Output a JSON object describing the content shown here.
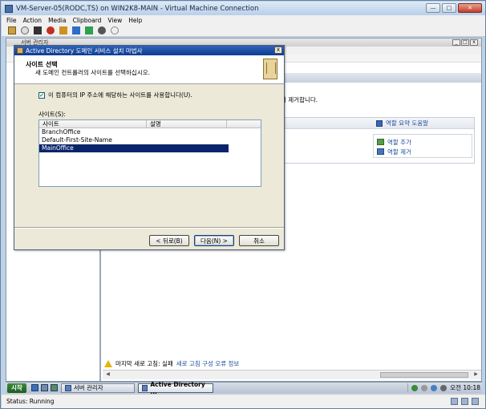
{
  "vm": {
    "title": "VM-Server-05(RODC,TS) on WIN2K8-MAIN - Virtual Machine Connection",
    "menu": [
      "File",
      "Action",
      "Media",
      "Clipboard",
      "View",
      "Help"
    ],
    "window_buttons": {
      "minimize": "—",
      "maximize": "□",
      "close": "✕"
    }
  },
  "server_manager": {
    "title": "서버 관리자",
    "description": "서 제거합니다.",
    "panel_header_link": "역할 요약 도움말",
    "actions": [
      "역할 추가",
      "역할 제거"
    ],
    "status_text": "마지막 새로 고침: 실패",
    "status_link": "새로 고침 구성 오류 정보"
  },
  "dialog": {
    "title": "Active Directory 도메인 서비스 설치 마법사",
    "heading": "사이트 선택",
    "subheading": "새 도메인 컨트롤러의 사이트를 선택하십시오.",
    "checkbox_label": "이 컴퓨터의 IP 주소에 해당하는 사이트를 사용합니다(U).",
    "checkbox_checked": true,
    "sites_label": "사이트(S):",
    "columns": [
      "사이트",
      "설명"
    ],
    "sites": [
      "BranchOffice",
      "Default-First-Site-Name",
      "MainOffice"
    ],
    "selected_site": "MainOffice",
    "buttons": {
      "back": "< 뒤로(B)",
      "next": "다음(N) >",
      "cancel": "취소"
    }
  },
  "taskbar": {
    "start": "시작",
    "tasks": [
      "서버 관리자",
      "Active Directory ..."
    ],
    "clock": "오전 10:18"
  },
  "statusbar": {
    "text": "Status: Running"
  }
}
